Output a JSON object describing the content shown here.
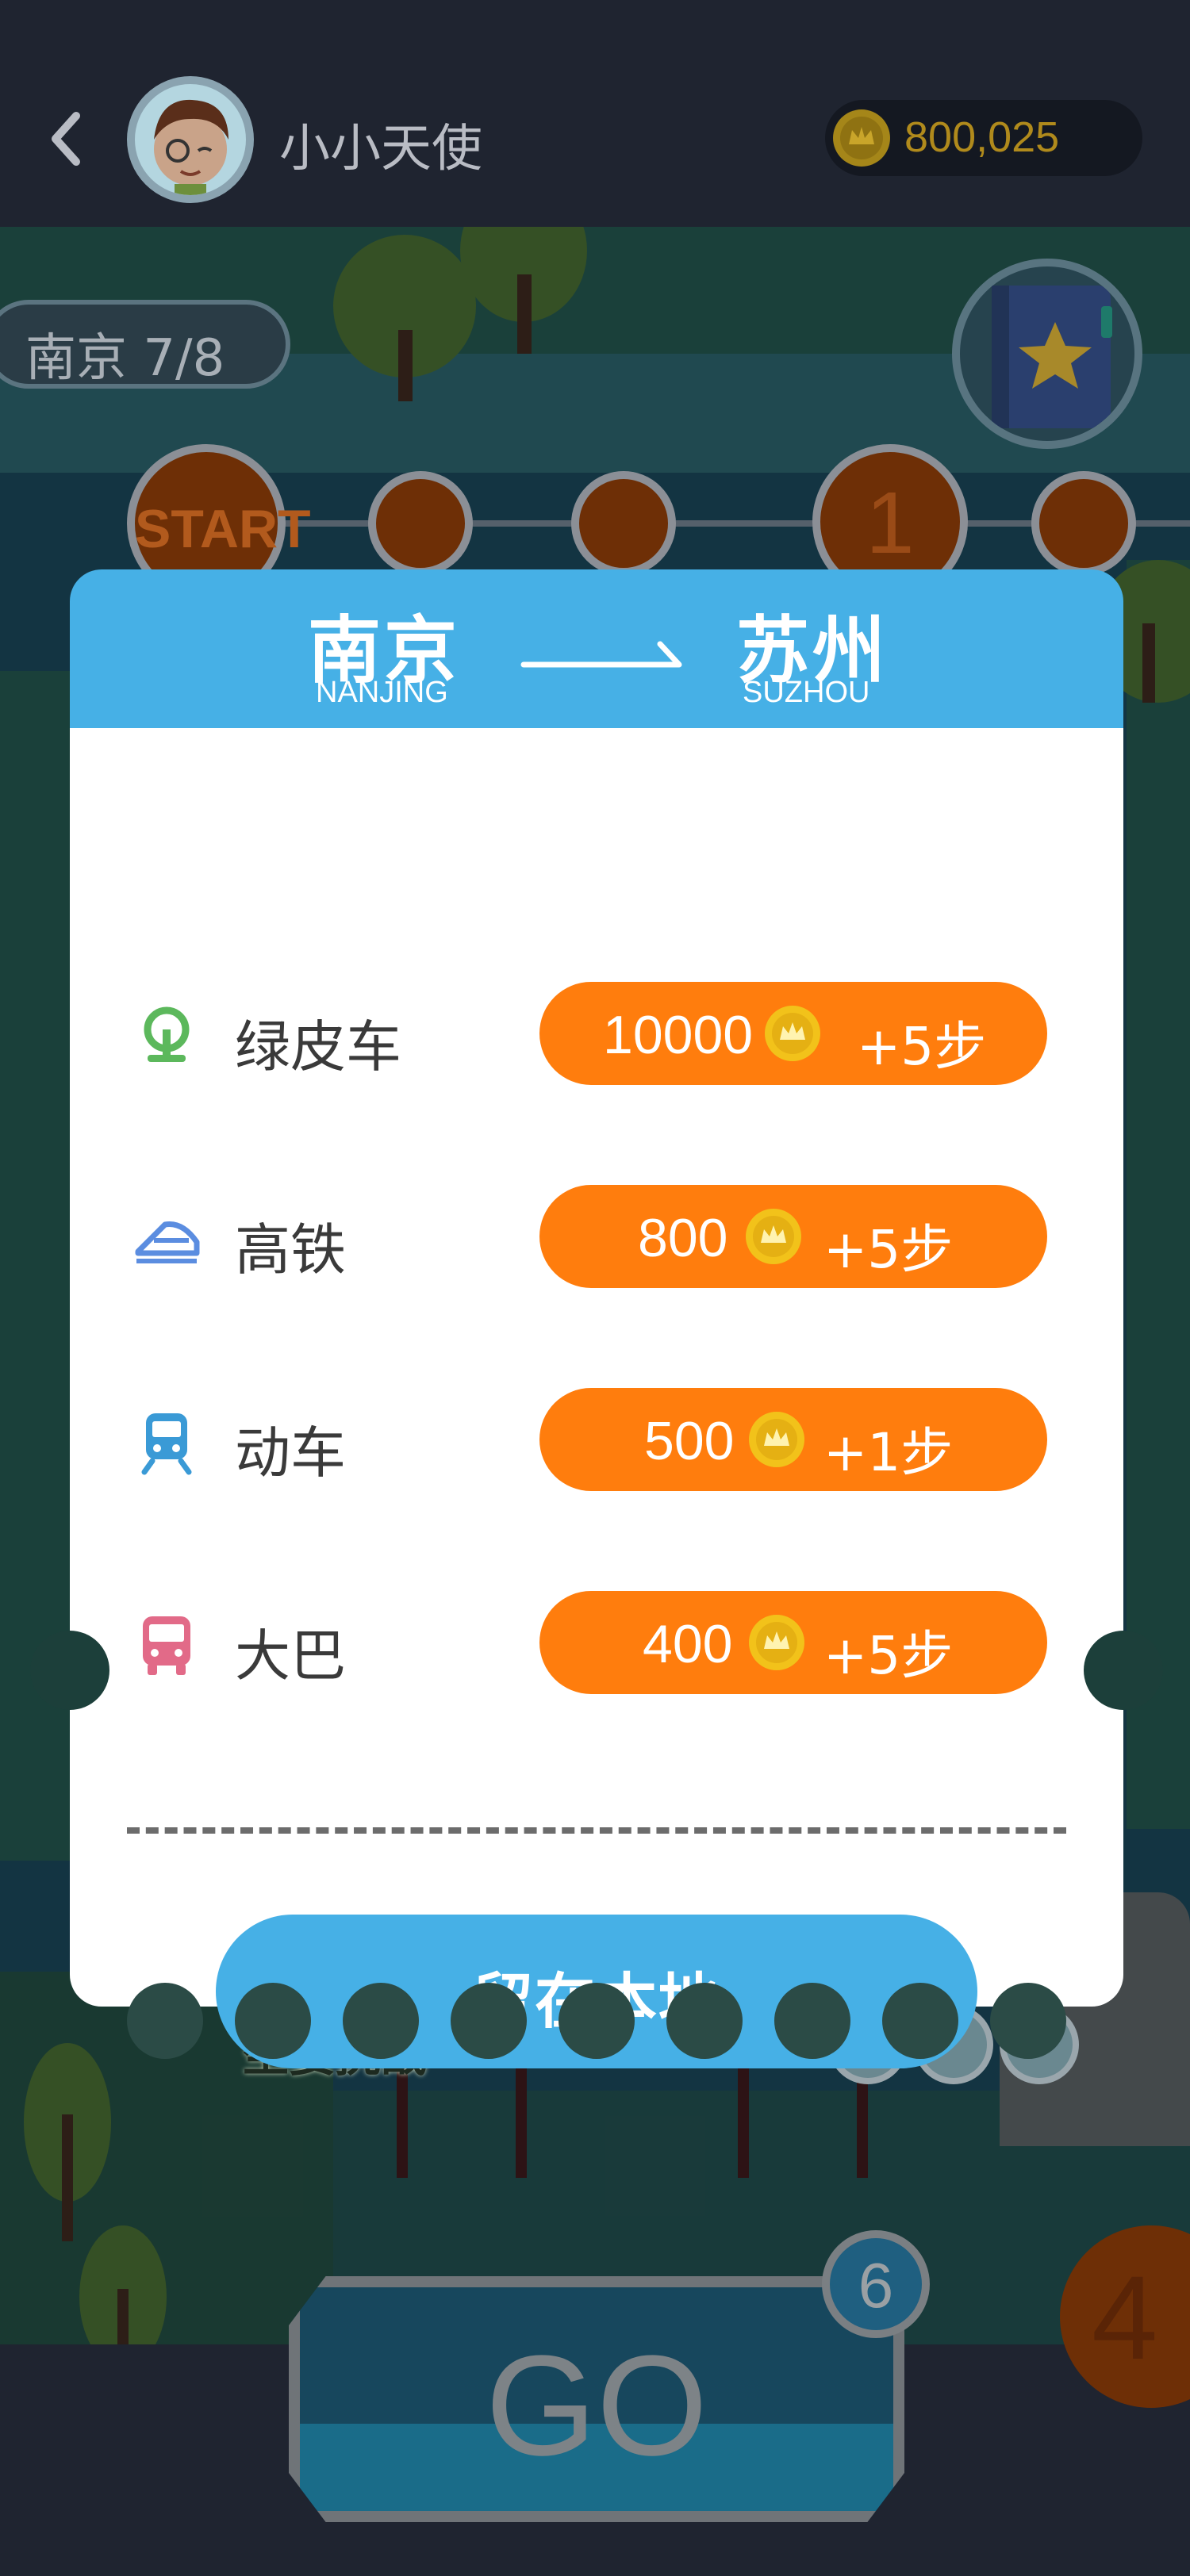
{
  "header": {
    "username": "小小天使",
    "coins": "800,025"
  },
  "board": {
    "current_city": "南京 7/8",
    "start_label": "START",
    "node_number": "1",
    "challenge_label": "坐姿挑战",
    "go_label": "GO",
    "steps_left": "6",
    "next_node_number": "4"
  },
  "modal": {
    "from_cn": "南京",
    "from_en": "NANJING",
    "to_cn": "苏州",
    "to_en": "SUZHOU",
    "options": [
      {
        "name": "绿皮车",
        "price": "10000",
        "bonus": "+5步",
        "icon": "green-train-icon",
        "icon_color": "#5cb85c"
      },
      {
        "name": "高铁",
        "price": "800",
        "bonus": "+5步",
        "icon": "bullet-train-icon",
        "icon_color": "#5b8de0"
      },
      {
        "name": "动车",
        "price": "500",
        "bonus": "+1步",
        "icon": "metro-train-icon",
        "icon_color": "#3a9ad6"
      },
      {
        "name": "大巴",
        "price": "400",
        "bonus": "+5步",
        "icon": "bus-icon",
        "icon_color": "#e26a88"
      }
    ],
    "stay_label": "留在本地"
  },
  "colors": {
    "accent_blue": "#46b0e6",
    "accent_orange": "#ff7d0d",
    "coin_gold": "#f2c21a"
  }
}
